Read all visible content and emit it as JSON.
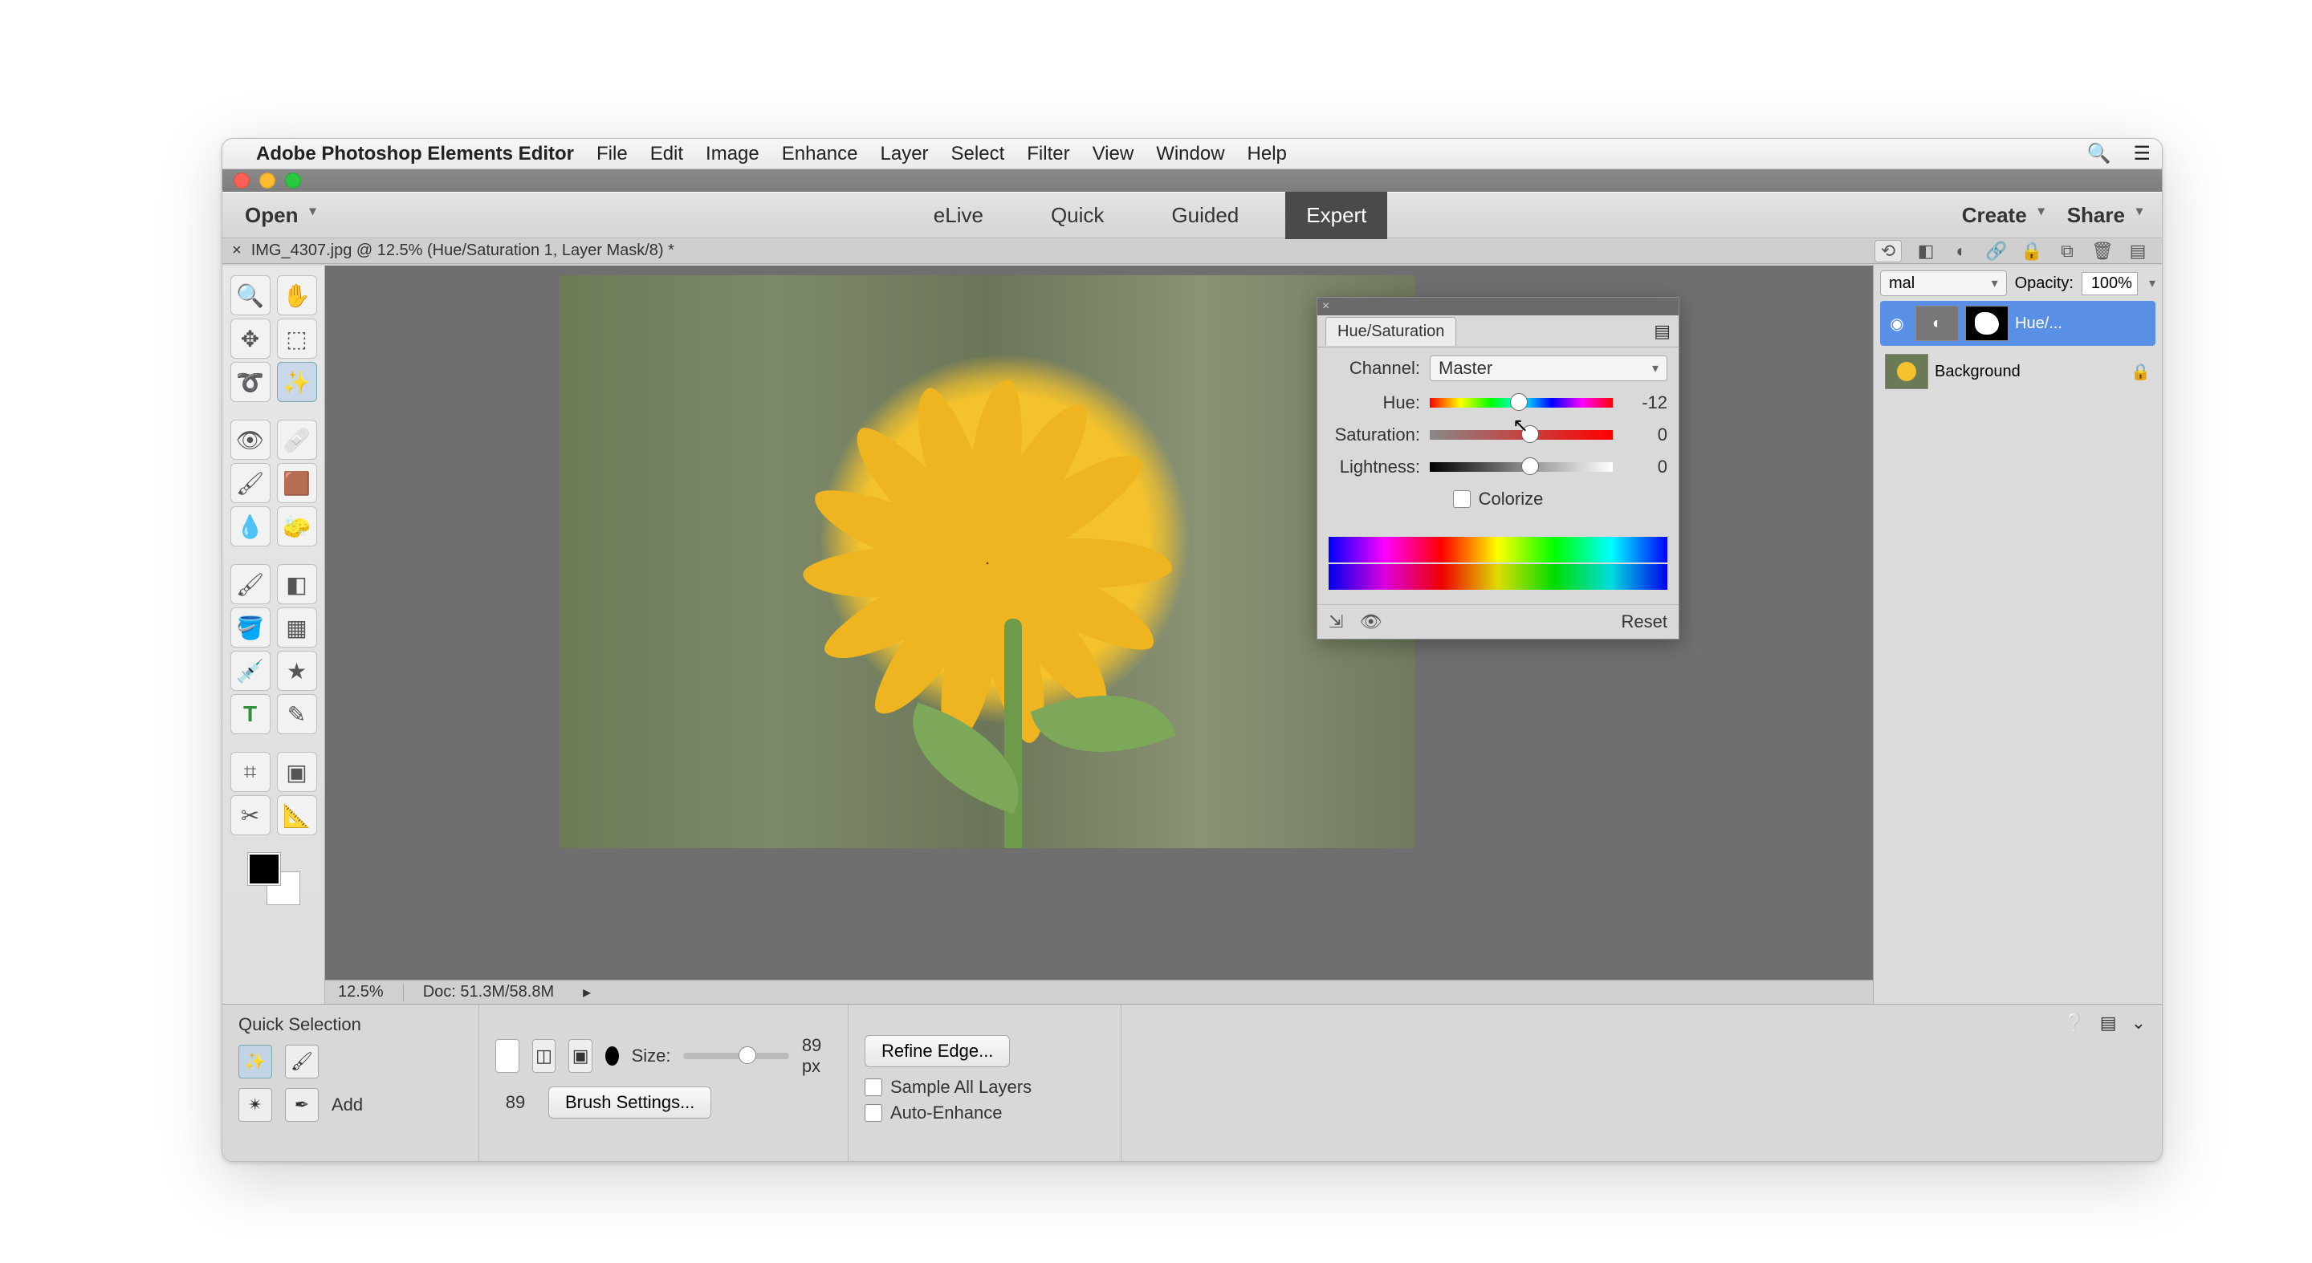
{
  "menubar": {
    "app": "Adobe Photoshop Elements Editor",
    "items": [
      "File",
      "Edit",
      "Image",
      "Enhance",
      "Layer",
      "Select",
      "Filter",
      "View",
      "Window",
      "Help"
    ]
  },
  "modebar": {
    "open": "Open",
    "modes": [
      "eLive",
      "Quick",
      "Guided",
      "Expert"
    ],
    "active": "Expert",
    "create": "Create",
    "share": "Share"
  },
  "document": {
    "tab_title": "IMG_4307.jpg @ 12.5% (Hue/Saturation 1, Layer Mask/8) *",
    "zoom": "12.5%",
    "docsize": "Doc: 51.3M/58.8M"
  },
  "layers": {
    "blend_mode_visible": "mal",
    "opacity_label": "Opacity:",
    "opacity_value": "100%",
    "items": [
      {
        "name": "Hue/..."
      },
      {
        "name": "Background"
      }
    ]
  },
  "hs_panel": {
    "title": "Hue/Saturation",
    "channel_label": "Channel:",
    "channel_value": "Master",
    "hue_label": "Hue:",
    "hue_value": "-12",
    "sat_label": "Saturation:",
    "sat_value": "0",
    "light_label": "Lightness:",
    "light_value": "0",
    "colorize": "Colorize",
    "reset": "Reset"
  },
  "options": {
    "title": "Quick Selection",
    "add": "Add",
    "size_label": "Size:",
    "size_value": "89 px",
    "size_num": "89",
    "brush_settings": "Brush Settings...",
    "refine": "Refine Edge...",
    "sample_all": "Sample All Layers",
    "auto_enhance": "Auto-Enhance"
  }
}
